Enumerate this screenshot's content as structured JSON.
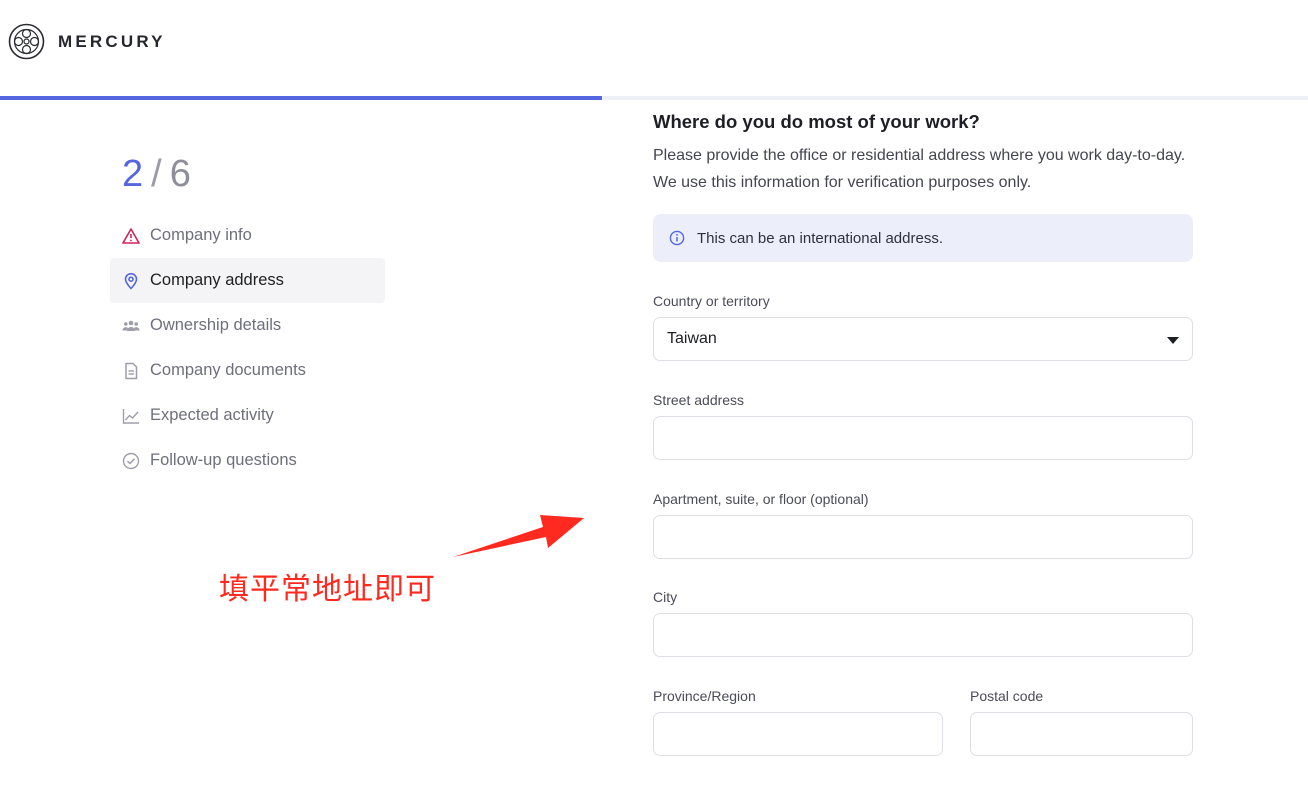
{
  "brand": {
    "name": "MERCURY"
  },
  "progress": {
    "fraction": 0.46
  },
  "stepper": {
    "current": "2",
    "separator": "/",
    "total": "6",
    "items": [
      {
        "label": "Company info",
        "icon": "warning-icon",
        "status": "error"
      },
      {
        "label": "Company address",
        "icon": "location-pin-icon",
        "status": "active"
      },
      {
        "label": "Ownership details",
        "icon": "people-icon",
        "status": "pending"
      },
      {
        "label": "Company documents",
        "icon": "document-icon",
        "status": "pending"
      },
      {
        "label": "Expected activity",
        "icon": "line-chart-icon",
        "status": "pending"
      },
      {
        "label": "Follow-up questions",
        "icon": "check-circle-icon",
        "status": "pending"
      }
    ]
  },
  "form": {
    "title": "Where do you do most of your work?",
    "description": "Please provide the office or residential address where you work day-to-day. We use this information for verification purposes only.",
    "info": {
      "icon": "info-icon",
      "text": "This can be an international address."
    },
    "fields": {
      "country": {
        "label": "Country or territory",
        "value": "Taiwan"
      },
      "street": {
        "label": "Street address",
        "value": ""
      },
      "apartment": {
        "label": "Apartment, suite, or floor (optional)",
        "value": ""
      },
      "city": {
        "label": "City",
        "value": ""
      },
      "province": {
        "label": "Province/Region",
        "value": ""
      },
      "postal": {
        "label": "Postal code",
        "value": ""
      }
    }
  },
  "annotation": {
    "text": "填平常地址即可",
    "color": "#ff2a1f"
  },
  "colors": {
    "accent": "#5466e0",
    "error": "#d1245a",
    "info_bg": "#eceef9"
  }
}
